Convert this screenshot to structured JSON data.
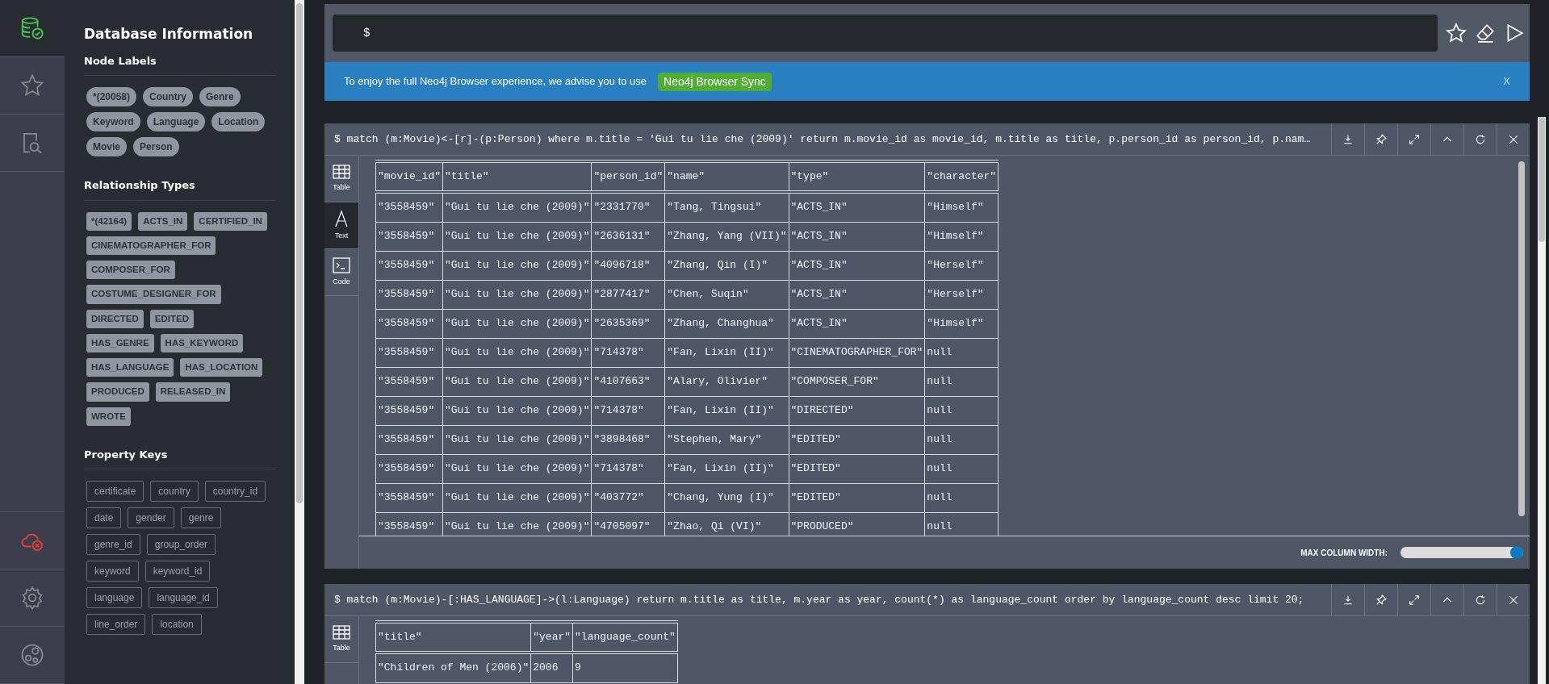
{
  "nav_top": [
    {
      "kind": "database",
      "selected": true
    },
    {
      "kind": "favorites",
      "selected": false
    },
    {
      "kind": "search-doc",
      "selected": false
    }
  ],
  "nav_bottom": [
    {
      "kind": "disconnected",
      "selected": false
    },
    {
      "kind": "settings",
      "selected": false
    },
    {
      "kind": "about",
      "selected": false
    }
  ],
  "db_info": {
    "title": "Database Information",
    "sections": [
      {
        "kind": "labels",
        "heading": "Node Labels",
        "items": [
          "*(20058)",
          "Country",
          "Genre",
          "Keyword",
          "Language",
          "Location",
          "Movie",
          "Person"
        ]
      },
      {
        "kind": "relationships",
        "heading": "Relationship Types",
        "items": [
          "*(42164)",
          "ACTS_IN",
          "CERTIFIED_IN",
          "CINEMATOGRAPHER_FOR",
          "COMPOSER_FOR",
          "COSTUME_DESIGNER_FOR",
          "DIRECTED",
          "EDITED",
          "HAS_GENRE",
          "HAS_KEYWORD",
          "HAS_LANGUAGE",
          "HAS_LOCATION",
          "PRODUCED",
          "RELEASED_IN",
          "WROTE"
        ]
      },
      {
        "kind": "properties",
        "heading": "Property Keys",
        "items": [
          "certificate",
          "country",
          "country_id",
          "date",
          "gender",
          "genre",
          "genre_id",
          "group_order",
          "keyword",
          "keyword_id",
          "language",
          "language_id",
          "line_order",
          "location"
        ]
      }
    ]
  },
  "editor": {
    "prompt": "$"
  },
  "banner": {
    "message": "To enjoy the full Neo4j Browser experience, we advise you to use",
    "link": "Neo4j Browser Sync",
    "close": "X"
  },
  "frames": [
    {
      "query": "$ match (m:Movie)<-[r]-(p:Person) where m.title = 'Gui tu lie che (2009)' return m.movie_id as movie_id, m.title as title, p.person_id as person_id, p.nam…",
      "tabs": [
        {
          "kind": "table",
          "label": "Table",
          "selected": false
        },
        {
          "kind": "text",
          "label": "Text",
          "selected": true
        },
        {
          "kind": "code",
          "label": "Code",
          "selected": false
        }
      ],
      "columns": [
        "\"movie_id\"",
        "\"title\"",
        "\"person_id\"",
        "\"name\"",
        "\"type\"",
        "\"character\""
      ],
      "rows": [
        [
          "\"3558459\"",
          "\"Gui tu lie che (2009)\"",
          "\"2331770\"",
          "\"Tang, Tingsui\"",
          "\"ACTS_IN\"",
          "\"Himself\""
        ],
        [
          "\"3558459\"",
          "\"Gui tu lie che (2009)\"",
          "\"2636131\"",
          "\"Zhang, Yang (VII)\"",
          "\"ACTS_IN\"",
          "\"Himself\""
        ],
        [
          "\"3558459\"",
          "\"Gui tu lie che (2009)\"",
          "\"4096718\"",
          "\"Zhang, Qin (I)\"",
          "\"ACTS_IN\"",
          "\"Herself\""
        ],
        [
          "\"3558459\"",
          "\"Gui tu lie che (2009)\"",
          "\"2877417\"",
          "\"Chen, Suqin\"",
          "\"ACTS_IN\"",
          "\"Herself\""
        ],
        [
          "\"3558459\"",
          "\"Gui tu lie che (2009)\"",
          "\"2635369\"",
          "\"Zhang, Changhua\"",
          "\"ACTS_IN\"",
          "\"Himself\""
        ],
        [
          "\"3558459\"",
          "\"Gui tu lie che (2009)\"",
          "\"714378\"",
          "\"Fan, Lixin (II)\"",
          "\"CINEMATOGRAPHER_FOR\"",
          "null"
        ],
        [
          "\"3558459\"",
          "\"Gui tu lie che (2009)\"",
          "\"4107663\"",
          "\"Alary, Olivier\"",
          "\"COMPOSER_FOR\"",
          "null"
        ],
        [
          "\"3558459\"",
          "\"Gui tu lie che (2009)\"",
          "\"714378\"",
          "\"Fan, Lixin (II)\"",
          "\"DIRECTED\"",
          "null"
        ],
        [
          "\"3558459\"",
          "\"Gui tu lie che (2009)\"",
          "\"3898468\"",
          "\"Stephen, Mary\"",
          "\"EDITED\"",
          "null"
        ],
        [
          "\"3558459\"",
          "\"Gui tu lie che (2009)\"",
          "\"714378\"",
          "\"Fan, Lixin (II)\"",
          "\"EDITED\"",
          "null"
        ],
        [
          "\"3558459\"",
          "\"Gui tu lie che (2009)\"",
          "\"403772\"",
          "\"Chang, Yung (I)\"",
          "\"EDITED\"",
          "null"
        ],
        [
          "\"3558459\"",
          "\"Gui tu lie che (2009)\"",
          "\"4705097\"",
          "\"Zhao, Qi (VI)\"",
          "\"PRODUCED\"",
          "null"
        ]
      ],
      "footer": {
        "label": "MAX COLUMN WIDTH:",
        "level": 1
      }
    },
    {
      "query": "$ match (m:Movie)-[:HAS_LANGUAGE]->(l:Language) return m.title as title, m.year as year, count(*) as language_count order by language_count desc limit 20;",
      "tabs": [
        {
          "kind": "table",
          "label": "Table",
          "selected": false
        }
      ],
      "columns": [
        "\"title\"",
        "\"year\"",
        "\"language_count\""
      ],
      "rows": [
        [
          "\"Children of Men (2006)\"",
          "2006",
          "9"
        ]
      ]
    }
  ]
}
